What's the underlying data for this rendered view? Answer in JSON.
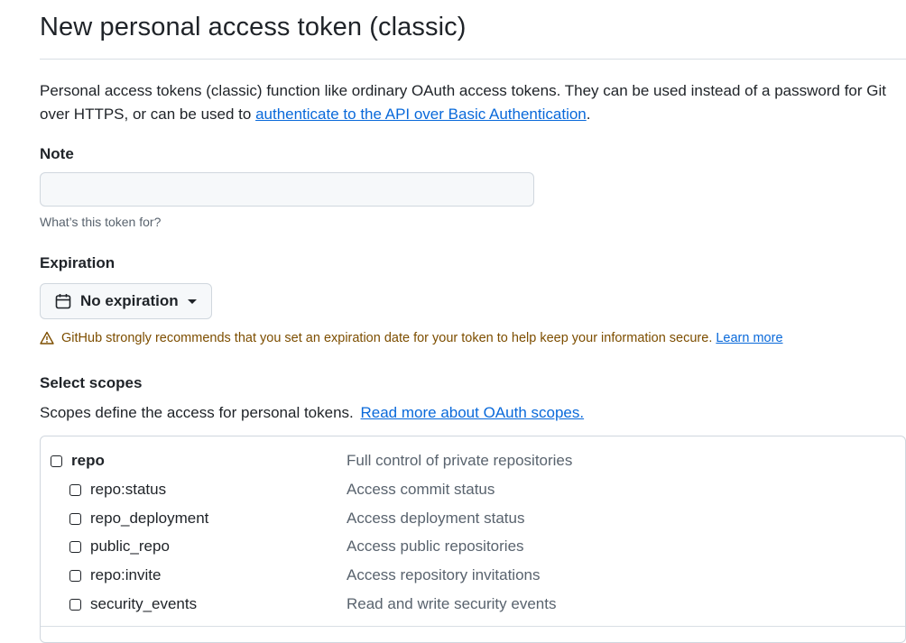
{
  "title": "New personal access token (classic)",
  "intro": {
    "text": "Personal access tokens (classic) function like ordinary OAuth access tokens. They can be used instead of a password for Git over HTTPS, or can be used to ",
    "link": "authenticate to the API over Basic Authentication",
    "suffix": "."
  },
  "note": {
    "label": "Note",
    "value": "",
    "placeholder": "",
    "hint": "What’s this token for?"
  },
  "expiration": {
    "label": "Expiration",
    "selected": "No expiration",
    "warning": "GitHub strongly recommends that you set an expiration date for your token to help keep your information secure.",
    "learn_more": "Learn more"
  },
  "scopes": {
    "label": "Select scopes",
    "description": "Scopes define the access for personal tokens.",
    "link": "Read more about OAuth scopes.",
    "items": [
      {
        "name": "repo",
        "description": "Full control of private repositories",
        "checked": false
      },
      {
        "name": "repo:status",
        "description": "Access commit status",
        "checked": false
      },
      {
        "name": "repo_deployment",
        "description": "Access deployment status",
        "checked": false
      },
      {
        "name": "public_repo",
        "description": "Access public repositories",
        "checked": false
      },
      {
        "name": "repo:invite",
        "description": "Access repository invitations",
        "checked": false
      },
      {
        "name": "security_events",
        "description": "Read and write security events",
        "checked": false
      }
    ]
  },
  "colors": {
    "link": "#0969da",
    "warning_text": "#7d4e00",
    "muted": "#59636e",
    "border": "#d0d7de"
  }
}
